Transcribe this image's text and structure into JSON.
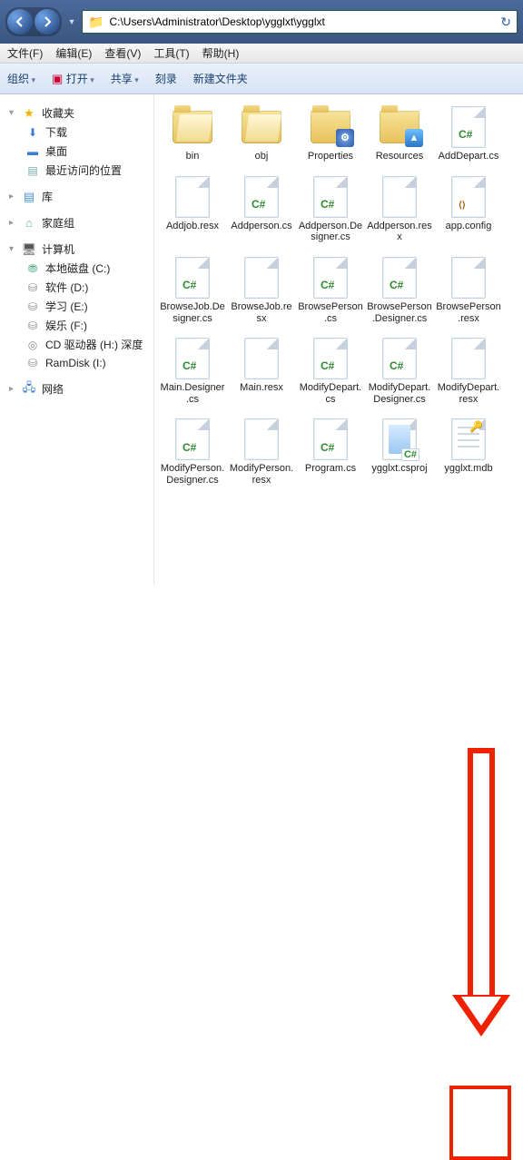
{
  "address": {
    "path": "C:\\Users\\Administrator\\Desktop\\ygglxt\\ygglxt"
  },
  "menu": {
    "file": "文件(F)",
    "edit": "编辑(E)",
    "view": "查看(V)",
    "tools": "工具(T)",
    "help": "帮助(H)"
  },
  "toolbar": {
    "organize": "组织",
    "open": "打开",
    "share": "共享",
    "burn": "刻录",
    "newfolder": "新建文件夹"
  },
  "sidebar": {
    "favorites": {
      "label": "收藏夹",
      "items": [
        {
          "label": "下载",
          "icon": "⬇",
          "color": "#3a7bd5"
        },
        {
          "label": "桌面",
          "icon": "▬",
          "color": "#3a7bd5"
        },
        {
          "label": "最近访问的位置",
          "icon": "▤",
          "color": "#7aa"
        }
      ]
    },
    "libraries": {
      "label": "库"
    },
    "homegroup": {
      "label": "家庭组"
    },
    "computer": {
      "label": "计算机",
      "items": [
        {
          "label": "本地磁盘 (C:)",
          "icon": "⛃",
          "color": "#5a8"
        },
        {
          "label": "软件 (D:)",
          "icon": "⛁",
          "color": "#888"
        },
        {
          "label": "学习 (E:)",
          "icon": "⛁",
          "color": "#888"
        },
        {
          "label": "娱乐 (F:)",
          "icon": "⛁",
          "color": "#888"
        },
        {
          "label": "CD 驱动器 (H:) 深度",
          "icon": "◎",
          "color": "#888"
        },
        {
          "label": "RamDisk (I:)",
          "icon": "⛁",
          "color": "#888"
        }
      ]
    },
    "network": {
      "label": "网络"
    }
  },
  "files": [
    {
      "name": "bin",
      "kind": "folder-open"
    },
    {
      "name": "obj",
      "kind": "folder-open"
    },
    {
      "name": "Properties",
      "kind": "folder-gear"
    },
    {
      "name": "Resources",
      "kind": "folder-pic"
    },
    {
      "name": "AddDepart.cs",
      "kind": "cs"
    },
    {
      "name": "Addjob.resx",
      "kind": "resx"
    },
    {
      "name": "Addperson.cs",
      "kind": "cs"
    },
    {
      "name": "Addperson.Designer.cs",
      "kind": "cs"
    },
    {
      "name": "Addperson.resx",
      "kind": "resx"
    },
    {
      "name": "app.config",
      "kind": "config"
    },
    {
      "name": "BrowseJob.Designer.cs",
      "kind": "cs"
    },
    {
      "name": "BrowseJob.resx",
      "kind": "resx"
    },
    {
      "name": "BrowsePerson.cs",
      "kind": "cs"
    },
    {
      "name": "BrowsePerson.Designer.cs",
      "kind": "cs"
    },
    {
      "name": "BrowsePerson.resx",
      "kind": "resx"
    },
    {
      "name": "Main.Designer.cs",
      "kind": "cs"
    },
    {
      "name": "Main.resx",
      "kind": "resx"
    },
    {
      "name": "ModifyDepart.cs",
      "kind": "cs"
    },
    {
      "name": "ModifyDepart.Designer.cs",
      "kind": "cs"
    },
    {
      "name": "ModifyDepart.resx",
      "kind": "resx"
    },
    {
      "name": "ModifyPerson.Designer.cs",
      "kind": "cs"
    },
    {
      "name": "ModifyPerson.resx",
      "kind": "resx"
    },
    {
      "name": "Program.cs",
      "kind": "cs"
    },
    {
      "name": "ygglxt.csproj",
      "kind": "csproj"
    },
    {
      "name": "ygglxt.mdb",
      "kind": "mdb"
    }
  ]
}
